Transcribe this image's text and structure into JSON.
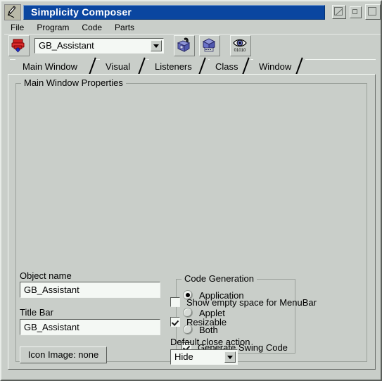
{
  "window": {
    "title": "Simplicity Composer",
    "icon": "composer-app-icon",
    "controls": [
      {
        "name": "minimize-button",
        "glyph": "diagonal-line"
      },
      {
        "name": "maximize-button",
        "glyph": "small-square"
      },
      {
        "name": "close-button",
        "glyph": "square"
      }
    ]
  },
  "menubar": {
    "items": [
      {
        "label": "File"
      },
      {
        "label": "Program"
      },
      {
        "label": "Code"
      },
      {
        "label": "Parts"
      }
    ]
  },
  "toolbar": {
    "print_icon": "printer-upload-icon",
    "component_combo": {
      "value": "GB_Assistant",
      "arrow": "chevron-down-icon"
    },
    "buttons": [
      {
        "name": "bean-lock-icon",
        "label": "bean-lock-icon"
      },
      {
        "name": "bean-package-icon",
        "label": "bean-package-icon"
      },
      {
        "name": "eye-binary-icon",
        "label": "eye-binary-icon"
      }
    ]
  },
  "tabs": {
    "selected": "Main Window",
    "items": [
      {
        "label": "Main Window"
      },
      {
        "label": "Visual"
      },
      {
        "label": "Listeners"
      },
      {
        "label": "Class"
      },
      {
        "label": "Window"
      }
    ]
  },
  "main_panel": {
    "group_title": "Main Window Properties",
    "object_name": {
      "label": "Object name",
      "value": "GB_Assistant"
    },
    "title_bar": {
      "label": "Title Bar",
      "value": "GB_Assistant"
    },
    "icon_image_button": {
      "label": "Icon Image: none"
    },
    "code_generation": {
      "group_title": "Code Generation",
      "radios": [
        {
          "label": "Application",
          "selected": true
        },
        {
          "label": "Applet",
          "selected": false
        },
        {
          "label": "Both",
          "selected": false
        }
      ],
      "checkbox": {
        "label": "Generate Swing Code",
        "checked": true
      }
    },
    "show_empty_space": {
      "label": "Show empty space for MenuBar",
      "checked": false
    },
    "resizable": {
      "label": "Resizable",
      "checked": true
    },
    "default_close_action": {
      "label": "Default close action",
      "value": "Hide",
      "arrow": "chevron-down-icon"
    }
  },
  "colors": {
    "window_bg": "#c9cec9",
    "title_active": "#0a46a0",
    "field_bg": "#f4f8f4",
    "icon_red": "#cc2020",
    "icon_blue": "#6a72c8"
  }
}
